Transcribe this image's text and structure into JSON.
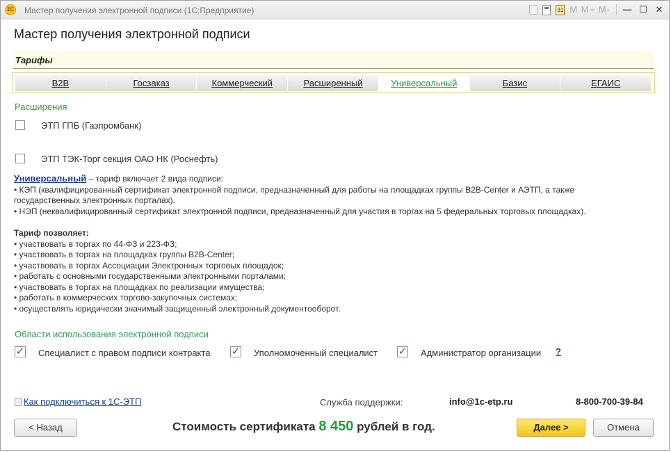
{
  "window": {
    "title": "Мастер получения электронной подписи  (1С:Предприятие)",
    "logo_text": "1С",
    "toolbar_m_text": "M  M+  M-"
  },
  "page": {
    "title": "Мастер получения электронной подписи"
  },
  "tariffs": {
    "header": "Тарифы",
    "tabs": [
      {
        "label": "B2B",
        "active": false
      },
      {
        "label": "Госзаказ",
        "active": false
      },
      {
        "label": "Коммерческий",
        "active": false
      },
      {
        "label": "Расширенный",
        "active": false
      },
      {
        "label": "Универсальный",
        "active": true
      },
      {
        "label": "Базис",
        "active": false
      },
      {
        "label": "ЕГАИС",
        "active": false
      }
    ]
  },
  "extensions": {
    "label": "Расширения",
    "items": [
      {
        "label": "ЭТП ГПБ (Газпромбанк)",
        "checked": false
      },
      {
        "label": "ЭТП ТЭК-Торг секция ОАО НК (Роснефть)",
        "checked": false
      }
    ]
  },
  "description": {
    "tariff_name": "Универсальный",
    "intro": " – тариф включает 2 вида подписи:",
    "kep_line1": "• КЭП (квалифицированный сертификат электронной подписи, предназначенный для работы на площадках группы B2B-Center и АЭТП, а также",
    "kep_line2": "государственных электронных порталах).",
    "nep_line": "• НЭП (неквалифицированный сертификат электронной подписи, предназначенный для участия в торгах на 5 федеральных торговых площадках).",
    "allows_title": "Тариф позволяет:",
    "allows": [
      "• участвовать в торгах по 44-ФЗ и 223-ФЗ;",
      "• участвовать в торгах на площадках группы B2B-Center;",
      "• участвовать в торгах Ассоциации Электронных торговых площадок;",
      "• работать с основными государственными электронными порталами;",
      "• участвовать в торгах на площадках по реализации имущества;",
      "• работать в коммерческих торгово-закупочных системах;",
      "• осуществлять юридически значимый защищенный электронный документооборот."
    ]
  },
  "usage": {
    "label": "Области использования электронной подписи",
    "items": [
      {
        "label": "Специалист с правом подписи контракта",
        "checked": true
      },
      {
        "label": "Уполномоченный специалист",
        "checked": true
      },
      {
        "label": "Администратор организации",
        "checked": true
      }
    ],
    "help": "?"
  },
  "footer": {
    "connect_link": "Как подключиться к 1С-ЭТП",
    "support_label": "Служба поддержки:",
    "support_email": "info@1c-etp.ru",
    "support_phone": "8-800-700-39-84",
    "price_prefix": "Стоимость сертификата ",
    "price_amount": "8 450",
    "price_suffix": " рублей в год.",
    "back_button": "< Назад",
    "next_button": "Далее >",
    "cancel_button": "Отмена"
  },
  "colors": {
    "accent_green": "#2e9b52",
    "link_blue": "#1b3f8f",
    "next_button_yellow": "#f2c51c",
    "price_green": "#1f9d3a"
  }
}
